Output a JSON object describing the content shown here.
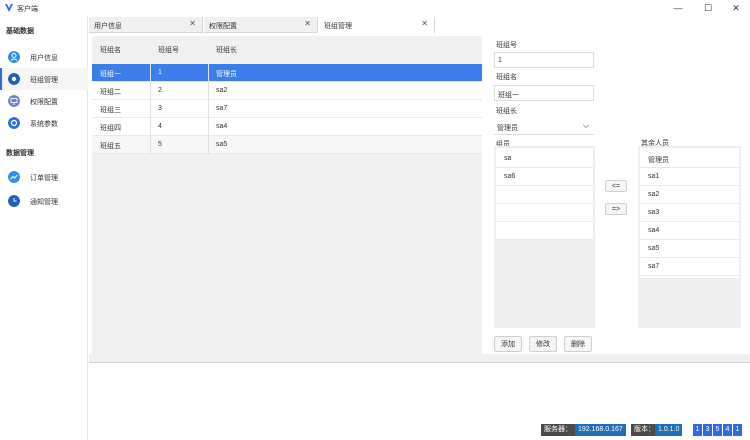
{
  "app": {
    "title": "客户端"
  },
  "window": {
    "min": "—",
    "max": "☐",
    "close": "✕"
  },
  "sidebar": {
    "groups": [
      {
        "title": "基础数据",
        "items": [
          {
            "label": "用户信息",
            "icon": "user-icon",
            "color": "#2d8cf0"
          },
          {
            "label": "班组管理",
            "icon": "team-icon",
            "color": "#1f5fb8"
          },
          {
            "label": "权限配置",
            "icon": "monitor-icon",
            "color": "#6a7fd8"
          },
          {
            "label": "系统参数",
            "icon": "gear-icon",
            "color": "#2d6cdf"
          }
        ]
      },
      {
        "title": "数据管理",
        "items": [
          {
            "label": "订单管理",
            "icon": "trend-icon",
            "color": "#2d8cf0"
          },
          {
            "label": "通知管理",
            "icon": "clock-icon",
            "color": "#1f5fb8"
          }
        ]
      }
    ]
  },
  "tabs": [
    {
      "label": "用户信息",
      "close": "✕"
    },
    {
      "label": "权限配置",
      "close": "✕"
    },
    {
      "label": "班组管理",
      "close": "✕"
    }
  ],
  "grid": {
    "headers": [
      "班组名",
      "班组号",
      "班组长"
    ],
    "rows": [
      [
        "班组一",
        "1",
        "管理员"
      ],
      [
        "班组二",
        "2",
        "sa2"
      ],
      [
        "班组三",
        "3",
        "sa7"
      ],
      [
        "班组四",
        "4",
        "sa4"
      ],
      [
        "班组五",
        "5",
        "sa5"
      ]
    ],
    "selected_row": 0
  },
  "form": {
    "team_no_label": "班组号",
    "team_no_value": "1",
    "team_name_label": "班组名",
    "team_name_value": "班组一",
    "leader_label": "班组长",
    "leader_value": "管理员",
    "members_label": "组员",
    "members": [
      "sa",
      "sa6"
    ],
    "others_label": "其余人员",
    "others": [
      "管理员",
      "sa1",
      "sa2",
      "sa3",
      "sa4",
      "sa5",
      "sa7"
    ],
    "move_left": "<=",
    "move_right": "=>",
    "add": "添加",
    "edit": "修改",
    "delete": "删除"
  },
  "status": {
    "server_label": "服务器：",
    "server_value": "192.168.0.167",
    "version_label": "版本：",
    "version_value": "1.0.1.0",
    "pages": [
      "1",
      "3",
      "5",
      "4",
      "1"
    ]
  }
}
